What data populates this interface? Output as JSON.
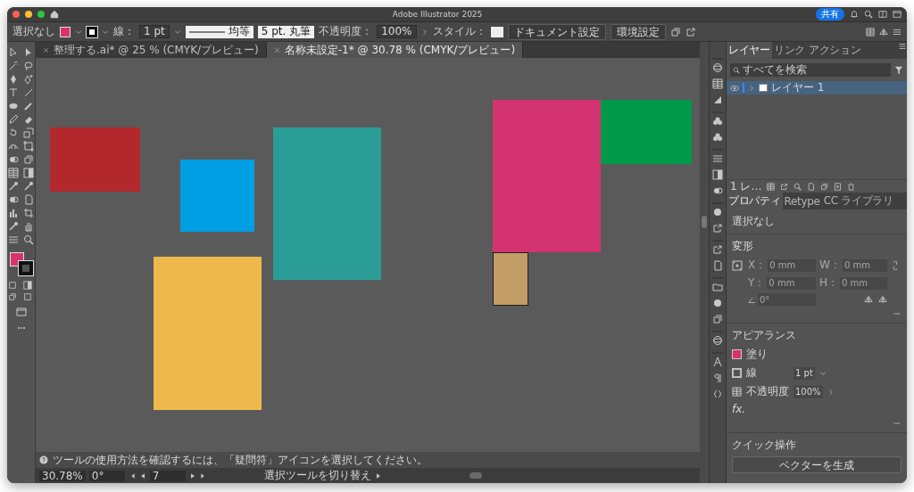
{
  "window": {
    "title": "Adobe Illustrator 2025",
    "share_button": "共有"
  },
  "control_bar": {
    "selection": "選択なし",
    "fill": {
      "color": "#d6336f"
    },
    "stroke_label": "線：",
    "stroke_weight": "1 pt",
    "stroke_profile": "均等",
    "brush": "5 pt. 丸筆",
    "opacity_label": "不透明度：",
    "opacity": "100%",
    "style_label": "スタイル：",
    "buttons": [
      "ドキュメント設定",
      "環境設定"
    ]
  },
  "document_tabs": [
    {
      "label": "整理する.ai* @ 25 % (CMYK/プレビュー)",
      "selected": false
    },
    {
      "label": "名称未設定-1* @ 30.78 % (CMYK/プレビュー)",
      "selected": true
    }
  ],
  "toolbar": {
    "fill": {
      "color": "#d6336f"
    }
  },
  "canvas": {
    "shapes": [
      {
        "kind": "rectangle",
        "color": "#b3282d",
        "outlined": false
      },
      {
        "kind": "rectangle",
        "color": "#009fe3",
        "outlined": false
      },
      {
        "kind": "rectangle",
        "color": "#2a9d97",
        "outlined": false
      },
      {
        "kind": "rectangle",
        "color": "#eeb84c",
        "outlined": false
      },
      {
        "kind": "rectangle",
        "color": "#d43371",
        "outlined": false
      },
      {
        "kind": "rectangle",
        "color": "#009849",
        "outlined": false
      },
      {
        "kind": "rectangle",
        "color": "#c49d66",
        "outlined": true
      }
    ]
  },
  "hint": "ツールの使用方法を確認するには、「疑問符」アイコンを選択してください。",
  "status_bar": {
    "zoom": "30.78%",
    "rotation": "0°",
    "artboard": "7",
    "tool": "選択ツールを切り替え"
  },
  "layers_panel": {
    "tabs": [
      {
        "label": "レイヤー",
        "selected": true
      },
      {
        "label": "リンク",
        "selected": false
      },
      {
        "label": "アクション",
        "selected": false
      }
    ],
    "search": {
      "placeholder": "すべてを検索"
    },
    "layers": [
      {
        "name": "レイヤー 1",
        "visible": true,
        "selected": true
      }
    ],
    "footer": "1 レ…"
  },
  "properties_panel": {
    "tabs": [
      {
        "label": "プロパティ",
        "selected": true
      },
      {
        "label": "Retype",
        "selected": false
      },
      {
        "label": "CC ライブラリ",
        "selected": false
      }
    ],
    "selection": "選択なし",
    "transform": {
      "title": "変形",
      "fields": [
        {
          "label": "X：",
          "value": "0 mm",
          "disabled": true
        },
        {
          "label": "W：",
          "value": "0 mm",
          "disabled": true
        },
        {
          "label": "Y：",
          "value": "0 mm",
          "disabled": true
        },
        {
          "label": "H：",
          "value": "0 mm",
          "disabled": true
        }
      ],
      "angle": {
        "value": "0°",
        "disabled": true
      }
    },
    "appearance": {
      "title": "アピアランス",
      "fill_label": "塗り",
      "fill": {
        "color": "#d6336f"
      },
      "stroke_label": "線",
      "stroke_weight": "1 pt",
      "opacity_label": "不透明度",
      "opacity": "100%",
      "effects": "fx."
    },
    "quick_actions": {
      "title": "クイック操作",
      "button": "ベクターを生成"
    }
  }
}
